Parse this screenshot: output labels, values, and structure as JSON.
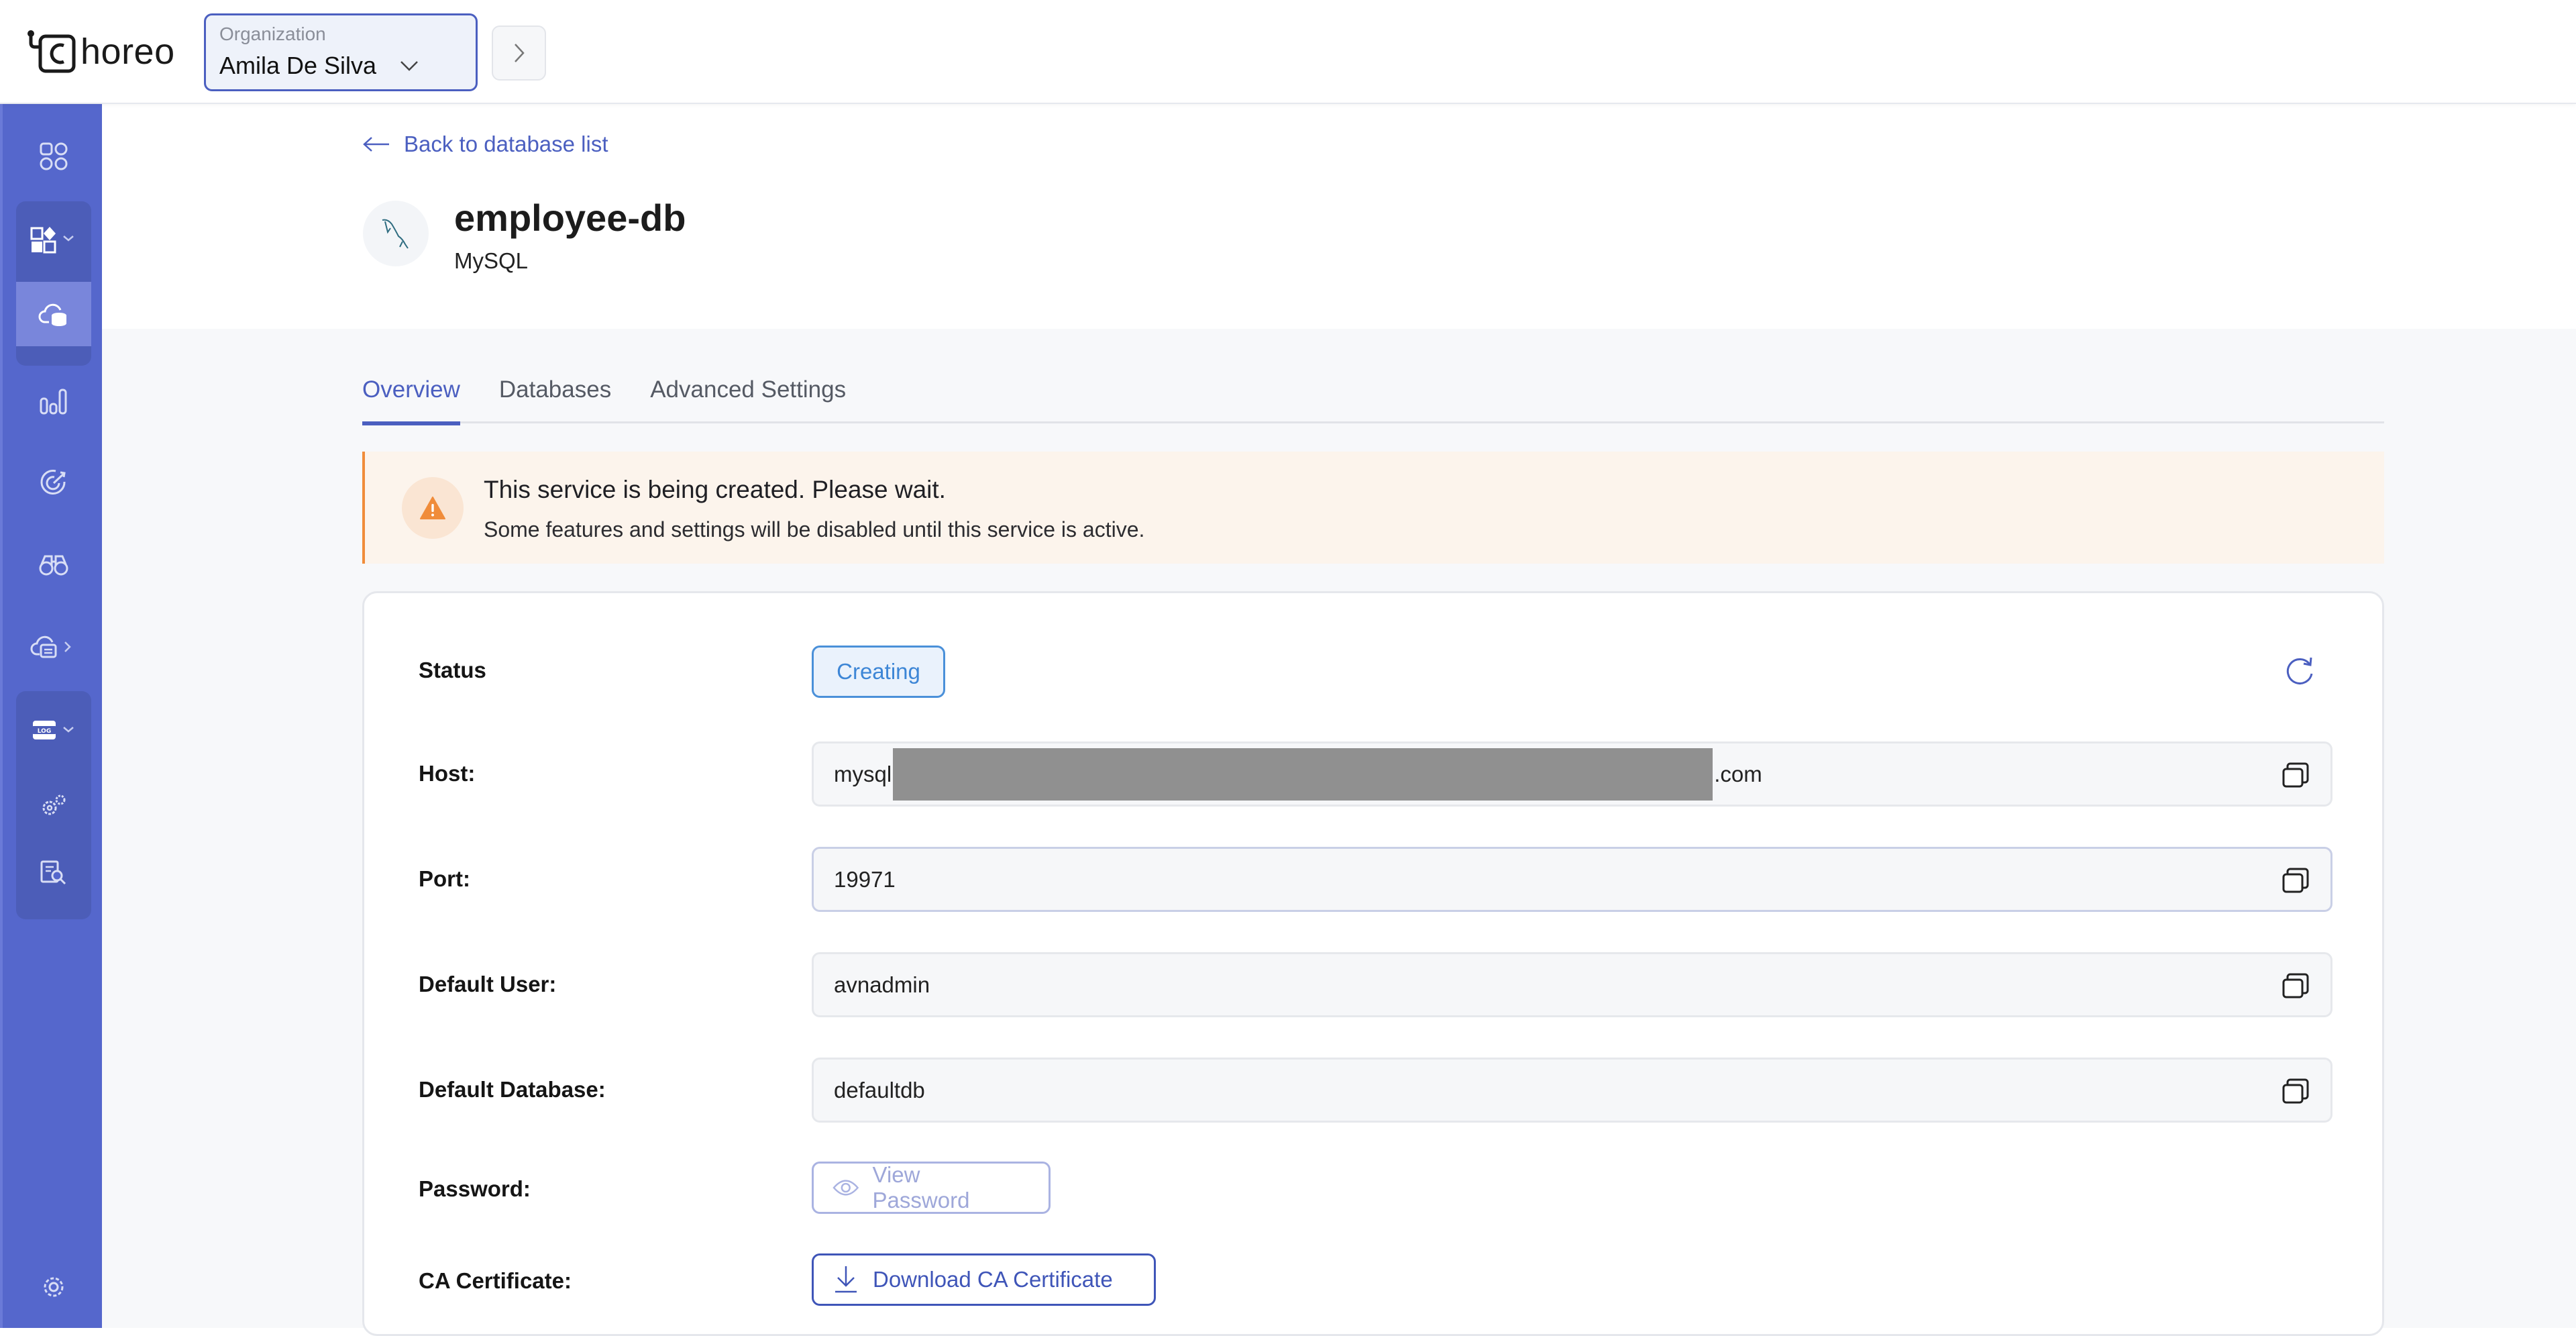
{
  "header": {
    "logo_text": "horeo",
    "org_label": "Organization",
    "org_value": "Amila De Silva"
  },
  "sidebar": {
    "items": [
      {
        "name": "overview",
        "icon": "grid-icon"
      },
      {
        "name": "components",
        "icon": "components-icon",
        "expanded": true
      },
      {
        "name": "databases",
        "icon": "cloud-database-icon",
        "active": true
      },
      {
        "name": "insights",
        "icon": "bar-chart-icon"
      },
      {
        "name": "targets",
        "icon": "target-icon"
      },
      {
        "name": "observability",
        "icon": "binoculars-icon"
      },
      {
        "name": "cloud-services",
        "icon": "cloud-list-icon"
      },
      {
        "name": "logs",
        "icon": "log-icon",
        "expanded": true
      },
      {
        "name": "log-settings",
        "icon": "gears-icon"
      },
      {
        "name": "audit",
        "icon": "doc-search-icon"
      },
      {
        "name": "settings",
        "icon": "gear-icon"
      }
    ]
  },
  "page": {
    "back_link": "Back to database list",
    "title": "employee-db",
    "subtitle": "MySQL"
  },
  "tabs": [
    {
      "label": "Overview",
      "active": true
    },
    {
      "label": "Databases",
      "active": false
    },
    {
      "label": "Advanced Settings",
      "active": false
    }
  ],
  "banner": {
    "title": "This service is being created. Please wait.",
    "message": "Some features and settings will be disabled until this service is active."
  },
  "details": {
    "status_label": "Status",
    "status_value": "Creating",
    "host_label": "Host:",
    "host_prefix": "mysql",
    "host_suffix": ".com",
    "port_label": "Port:",
    "port_value": "19971",
    "user_label": "Default User:",
    "user_value": "avnadmin",
    "database_label": "Default Database:",
    "database_value": "defaultdb",
    "password_label": "Password:",
    "password_button": "View Password",
    "ca_label": "CA Certificate:",
    "ca_button": "Download CA Certificate"
  },
  "colors": {
    "primary": "#4b5fc0",
    "sidebar": "#5567cc",
    "warning": "#f08c3a",
    "status_blue": "#3d86d6"
  }
}
